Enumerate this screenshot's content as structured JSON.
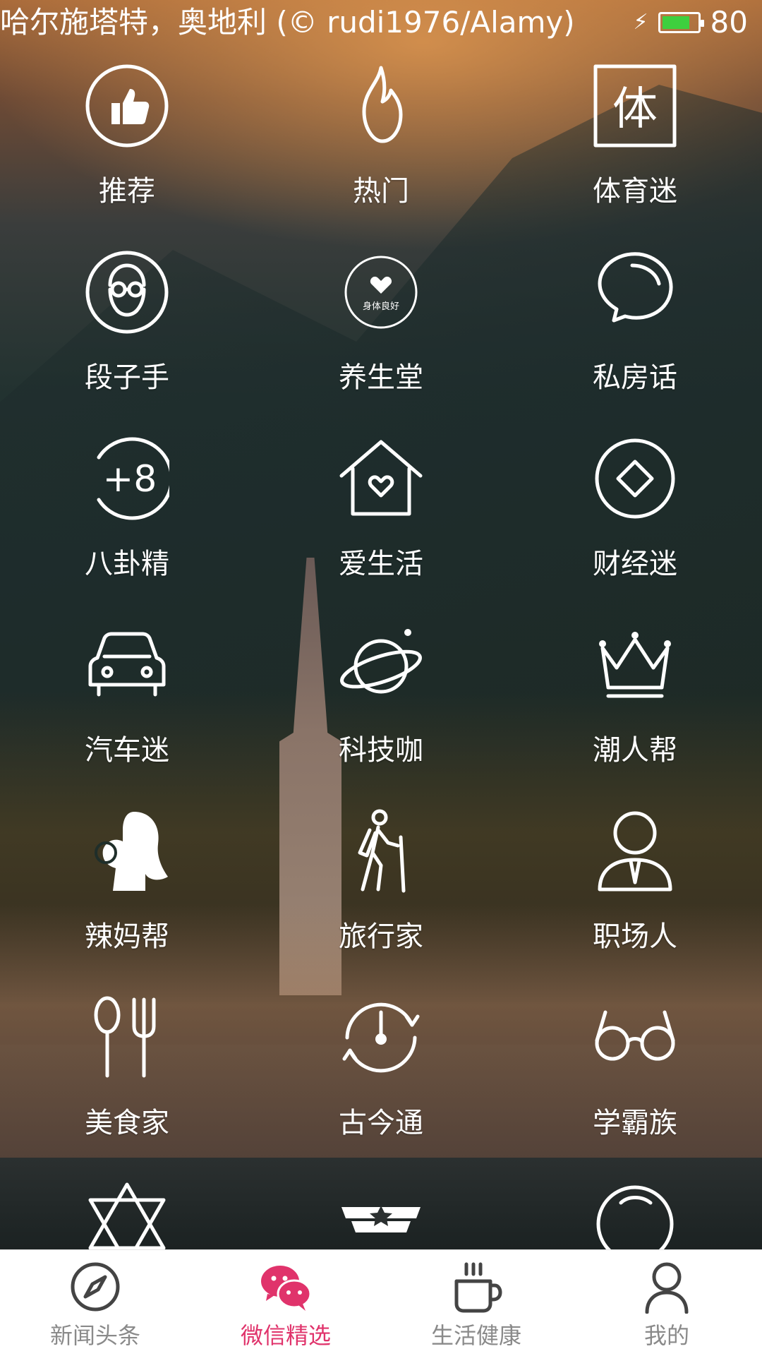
{
  "status_bar": {
    "caption": "哈尔施塔特，奥地利 (© rudi1976/Alamy)",
    "battery_level": 80,
    "battery_text": "80"
  },
  "categories": [
    {
      "label": "推荐",
      "icon": "thumbs-up-icon"
    },
    {
      "label": "热门",
      "icon": "flame-icon"
    },
    {
      "label": "体育迷",
      "icon": "sports-box-icon",
      "icon_text": "体"
    },
    {
      "label": "段子手",
      "icon": "glasses-face-icon"
    },
    {
      "label": "养生堂",
      "icon": "health-heart-badge-icon",
      "icon_text": "身体良好"
    },
    {
      "label": "私房话",
      "icon": "speech-bubble-icon"
    },
    {
      "label": "八卦精",
      "icon": "plus-eight-icon",
      "icon_text": "+8"
    },
    {
      "label": "爱生活",
      "icon": "house-heart-icon"
    },
    {
      "label": "财经迷",
      "icon": "diamond-coin-icon"
    },
    {
      "label": "汽车迷",
      "icon": "car-icon"
    },
    {
      "label": "科技咖",
      "icon": "planet-icon"
    },
    {
      "label": "潮人帮",
      "icon": "crown-icon"
    },
    {
      "label": "辣妈帮",
      "icon": "mother-baby-icon"
    },
    {
      "label": "旅行家",
      "icon": "hiker-icon"
    },
    {
      "label": "职场人",
      "icon": "businessman-icon"
    },
    {
      "label": "美食家",
      "icon": "fork-spoon-icon"
    },
    {
      "label": "古今通",
      "icon": "clock-rotate-icon"
    },
    {
      "label": "学霸族",
      "icon": "round-glasses-icon"
    },
    {
      "label": "",
      "icon": "star-of-david-icon"
    },
    {
      "label": "",
      "icon": "star-badge-icon"
    },
    {
      "label": "",
      "icon": "circle-arc-icon"
    }
  ],
  "bottom_nav": {
    "items": [
      {
        "label": "新闻头条",
        "icon": "compass-icon",
        "active": false
      },
      {
        "label": "微信精选",
        "icon": "wechat-icon",
        "active": true
      },
      {
        "label": "生活健康",
        "icon": "coffee-cup-icon",
        "active": false
      },
      {
        "label": "我的",
        "icon": "person-icon",
        "active": false
      }
    ],
    "active_color": "#e0336b"
  }
}
